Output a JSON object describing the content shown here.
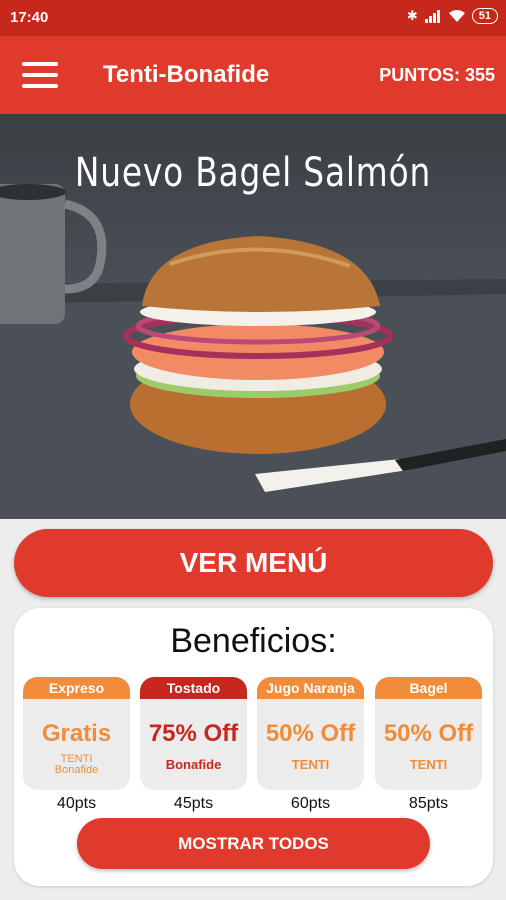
{
  "status_bar": {
    "time": "17:40",
    "battery": "51"
  },
  "app_bar": {
    "title": "Tenti-Bonafide",
    "points": "PUNTOS: 355"
  },
  "hero": {
    "title": "Nuevo Bagel Salmón"
  },
  "menu_button": {
    "label": "VER MENÚ"
  },
  "benefits": {
    "title": "Beneficios:",
    "items": [
      {
        "tag": "Expreso",
        "offer": "Gratis",
        "brand_line1": "TENTI",
        "brand_line2": "Bonafide",
        "points": "40pts",
        "accent": "#f08c3a"
      },
      {
        "tag": "Tostado",
        "offer": "75% Off",
        "brand": "Bonafide",
        "points": "45pts",
        "accent": "#c8271f"
      },
      {
        "tag": "Jugo Naranja",
        "offer": "50% Off",
        "brand": "TENTI",
        "points": "60pts",
        "accent": "#f08c3a"
      },
      {
        "tag": "Bagel",
        "offer": "50% Off",
        "brand": "TENTI",
        "points": "85pts",
        "accent": "#f08c3a"
      }
    ],
    "show_all_label": "MOSTRAR TODOS"
  },
  "colors": {
    "primary": "#e03a2c",
    "status_bar": "#c6281c",
    "orange": "#f08c3a"
  }
}
